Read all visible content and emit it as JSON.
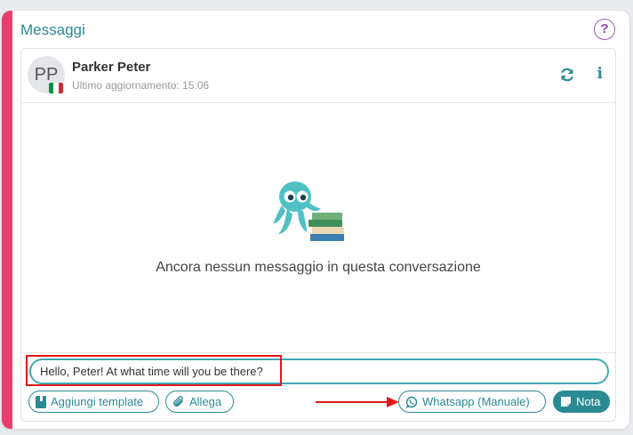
{
  "section": {
    "title": "Messaggi",
    "help_label": "?"
  },
  "contact": {
    "initials": "PP",
    "name": "Parker Peter",
    "last_update": "Ultimo aggiornamento: 15:06",
    "flag": "Italy",
    "info_label": "i"
  },
  "conversation": {
    "empty_message": "Ancora nessun messaggio in questa conversazione"
  },
  "composer": {
    "input_value": "Hello, Peter! At what time will you be there?",
    "add_template_label": "Aggiungi template",
    "attach_label": "Allega",
    "whatsapp_label": "Whatsapp (Manuale)",
    "note_label": "Nota"
  },
  "colors": {
    "accent_bar": "#e83e6c",
    "teal": "#2a8a94",
    "help": "#8e44ad",
    "annotation": "#e01919"
  },
  "icons": [
    "refresh-icon",
    "info-icon",
    "book-icon",
    "paperclip-icon",
    "whatsapp-icon",
    "note-icon",
    "octopus-mascot"
  ]
}
